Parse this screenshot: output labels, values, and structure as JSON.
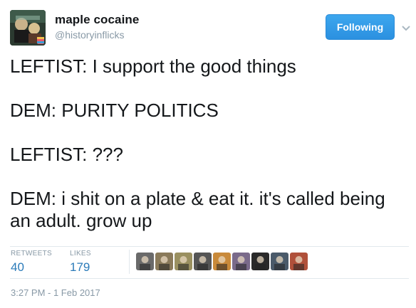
{
  "user": {
    "display_name": "maple cocaine",
    "handle": "@historyinflicks",
    "avatar_icon": "profile-avatar"
  },
  "follow_button": {
    "label": "Following",
    "color": "#2b90e0"
  },
  "caret_icon": "chevron-down-icon",
  "tweet": {
    "lines": [
      "LEFTIST: I support the good things",
      "DEM: PURITY POLITICS",
      "LEFTIST: ???",
      "DEM: i shit on a plate & eat it. it's called being an adult. grow up"
    ],
    "timestamp": "3:27 PM - 1 Feb 2017"
  },
  "stats": {
    "retweets_label": "RETWEETS",
    "retweets_count": "40",
    "likes_label": "LIKES",
    "likes_count": "179"
  },
  "likers": [
    {
      "icon": "liker-avatar-1",
      "color": "#6a6a6a"
    },
    {
      "icon": "liker-avatar-2",
      "color": "#8a7a5a"
    },
    {
      "icon": "liker-avatar-3",
      "color": "#9a9060"
    },
    {
      "icon": "liker-avatar-4",
      "color": "#555555"
    },
    {
      "icon": "liker-avatar-5",
      "color": "#c98a3a"
    },
    {
      "icon": "liker-avatar-6",
      "color": "#7a6a8a"
    },
    {
      "icon": "liker-avatar-7",
      "color": "#2a2a2a"
    },
    {
      "icon": "liker-avatar-8",
      "color": "#4a5a6a"
    },
    {
      "icon": "liker-avatar-9",
      "color": "#b0503a"
    }
  ],
  "colors": {
    "link_blue": "#2b7bb9",
    "muted_gray": "#8899a6",
    "divider": "#e1e8ed"
  }
}
